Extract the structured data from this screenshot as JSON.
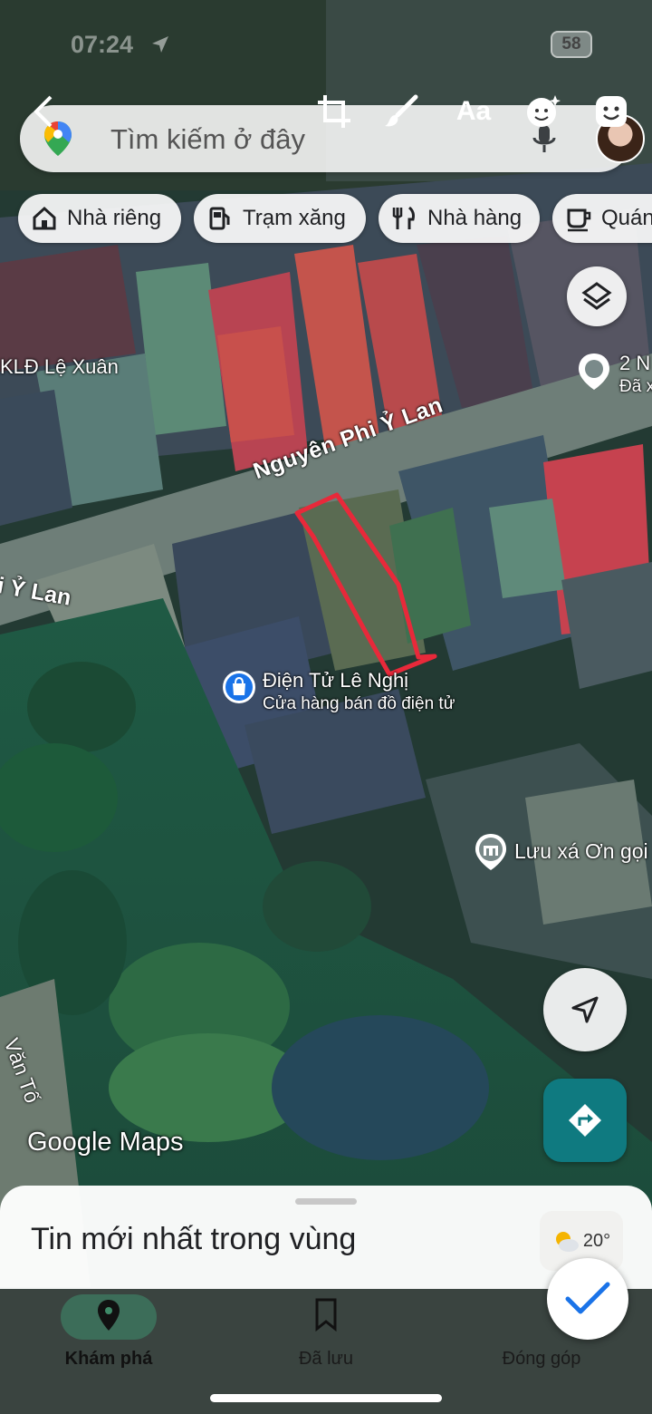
{
  "status_bar": {
    "time": "07:24",
    "battery": "58"
  },
  "editor": {
    "text_tool_label": "Aa"
  },
  "search": {
    "placeholder": "Tìm kiếm ở đây"
  },
  "chips": [
    {
      "label": "Nhà riêng",
      "icon": "home-icon"
    },
    {
      "label": "Trạm xăng",
      "icon": "gas-station-icon"
    },
    {
      "label": "Nhà hàng",
      "icon": "restaurant-icon"
    },
    {
      "label": "Quán",
      "icon": "cafe-icon"
    }
  ],
  "map": {
    "labels": {
      "kld": "KLĐ Lệ Xuân",
      "street_main": "Nguyên Phi Ỷ Lan",
      "street_left": "i Ỷ Lan",
      "street_bottom": "Văn Tố",
      "poi_right_1": "2 N",
      "poi_right_1_sub": "Đã x",
      "shop_name": "Điện Tử Lê Nghị",
      "shop_sub": "Cửa hàng bán đồ điện tử",
      "temple": "Lưu xá Ơn gọi",
      "watermark": "Google Maps"
    },
    "highlight_color": "#e8293a"
  },
  "sheet": {
    "title": "Tin mới nhất trong vùng",
    "weather": "20°"
  },
  "nav": [
    {
      "label": "Khám phá",
      "icon": "explore-pin-icon"
    },
    {
      "label": "Đã lưu",
      "icon": "bookmark-icon"
    },
    {
      "label": "Đóng góp",
      "icon": "add-circle-icon"
    }
  ]
}
